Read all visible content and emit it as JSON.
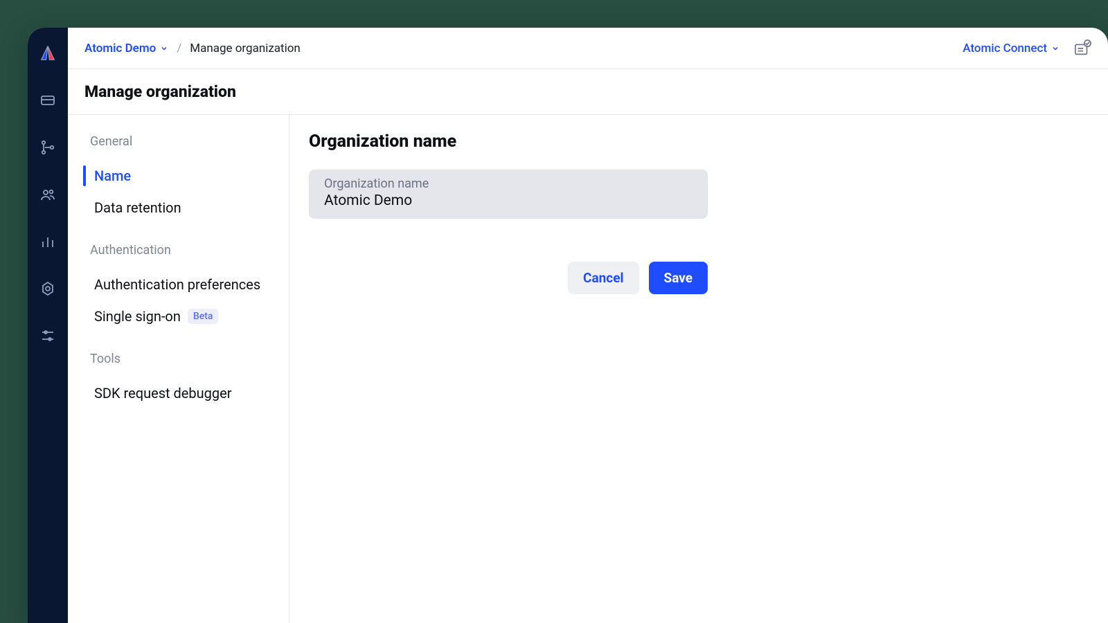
{
  "breadcrumb": {
    "org_name": "Atomic Demo",
    "page": "Manage organization"
  },
  "topbar": {
    "connect_label": "Atomic Connect"
  },
  "page_title": "Manage organization",
  "sidenav": {
    "groups": {
      "general": {
        "label": "General"
      },
      "auth": {
        "label": "Authentication"
      },
      "tools": {
        "label": "Tools"
      }
    },
    "items": {
      "name": {
        "label": "Name"
      },
      "data_retention": {
        "label": "Data retention"
      },
      "auth_prefs": {
        "label": "Authentication preferences"
      },
      "sso": {
        "label": "Single sign-on",
        "badge": "Beta"
      },
      "sdk_debugger": {
        "label": "SDK request debugger"
      }
    }
  },
  "form": {
    "heading": "Organization name",
    "field_label": "Organization name",
    "field_value": "Atomic Demo",
    "cancel_label": "Cancel",
    "save_label": "Save"
  },
  "rail_icons": [
    "logo",
    "cards",
    "branch",
    "users",
    "analytics",
    "settings-gear",
    "sliders"
  ]
}
